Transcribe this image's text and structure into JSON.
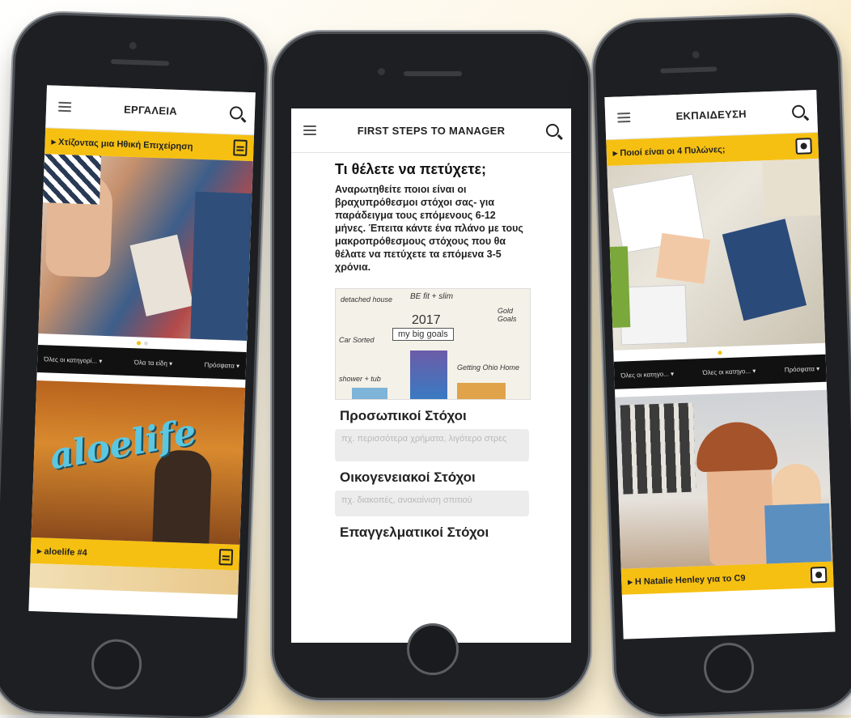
{
  "left_phone": {
    "title": "ΕΡΓΑΛΕΙΑ",
    "banner1_label": "Χτίζοντας μια Ηθική Επιχείρηση",
    "filters": [
      "Όλες οι κατηγορί...",
      "Όλα τα είδη",
      "Πρόσφατα"
    ],
    "feature_text": "aloelife",
    "banner2_label": "aloelife #4",
    "icons": {
      "menu": "hamburger-icon",
      "search": "search-icon",
      "doc": "document-icon"
    }
  },
  "center_phone": {
    "title": "FIRST STEPS TO MANAGER",
    "heading": "Τι θέλετε να πετύχετε;",
    "paragraph": "Αναρωτηθείτε ποιοι είναι οι βραχυπρόθεσμοι στόχοι σας- για παράδειγμα τους επόμενους 6-12 μήνες. Έπειτα κάντε ένα πλάνο με τους μακροπρόθεσμους στόχους που θα θέλατε να πετύχετε τα επόμενα 3-5 χρόνια.",
    "sketch_text": {
      "year": "2017",
      "center": "my big goals",
      "top": "BE fit + slim",
      "left1": "detached house",
      "left2": "Car Sorted",
      "left3": "shower + tub",
      "right1": "Gold Goals",
      "right2": "Getting Ohio Home"
    },
    "section1_heading": "Προσωπικοί Στόχοι",
    "section1_placeholder": "πχ. περισσότερα χρήματα, λιγότερο στρες",
    "section2_heading": "Οικογενειακοί Στόχοι",
    "section2_placeholder": "πχ. διακοπές, ανακαίνιση σπιτιού",
    "section3_heading": "Επαγγελματικοί Στόχοι"
  },
  "right_phone": {
    "title": "ΕΚΠΑΙΔΕΥΣΗ",
    "banner1_label": "Ποιοί είναι οι 4 Πυλώνες;",
    "filters": [
      "Όλες οι κατηγο...",
      "Όλες οι κατηγο...",
      "Πρόσφατα"
    ],
    "banner2_label": "Η Natalie Henley για το C9"
  },
  "colors": {
    "accent": "#f6c012",
    "filter_bg": "#111111"
  }
}
